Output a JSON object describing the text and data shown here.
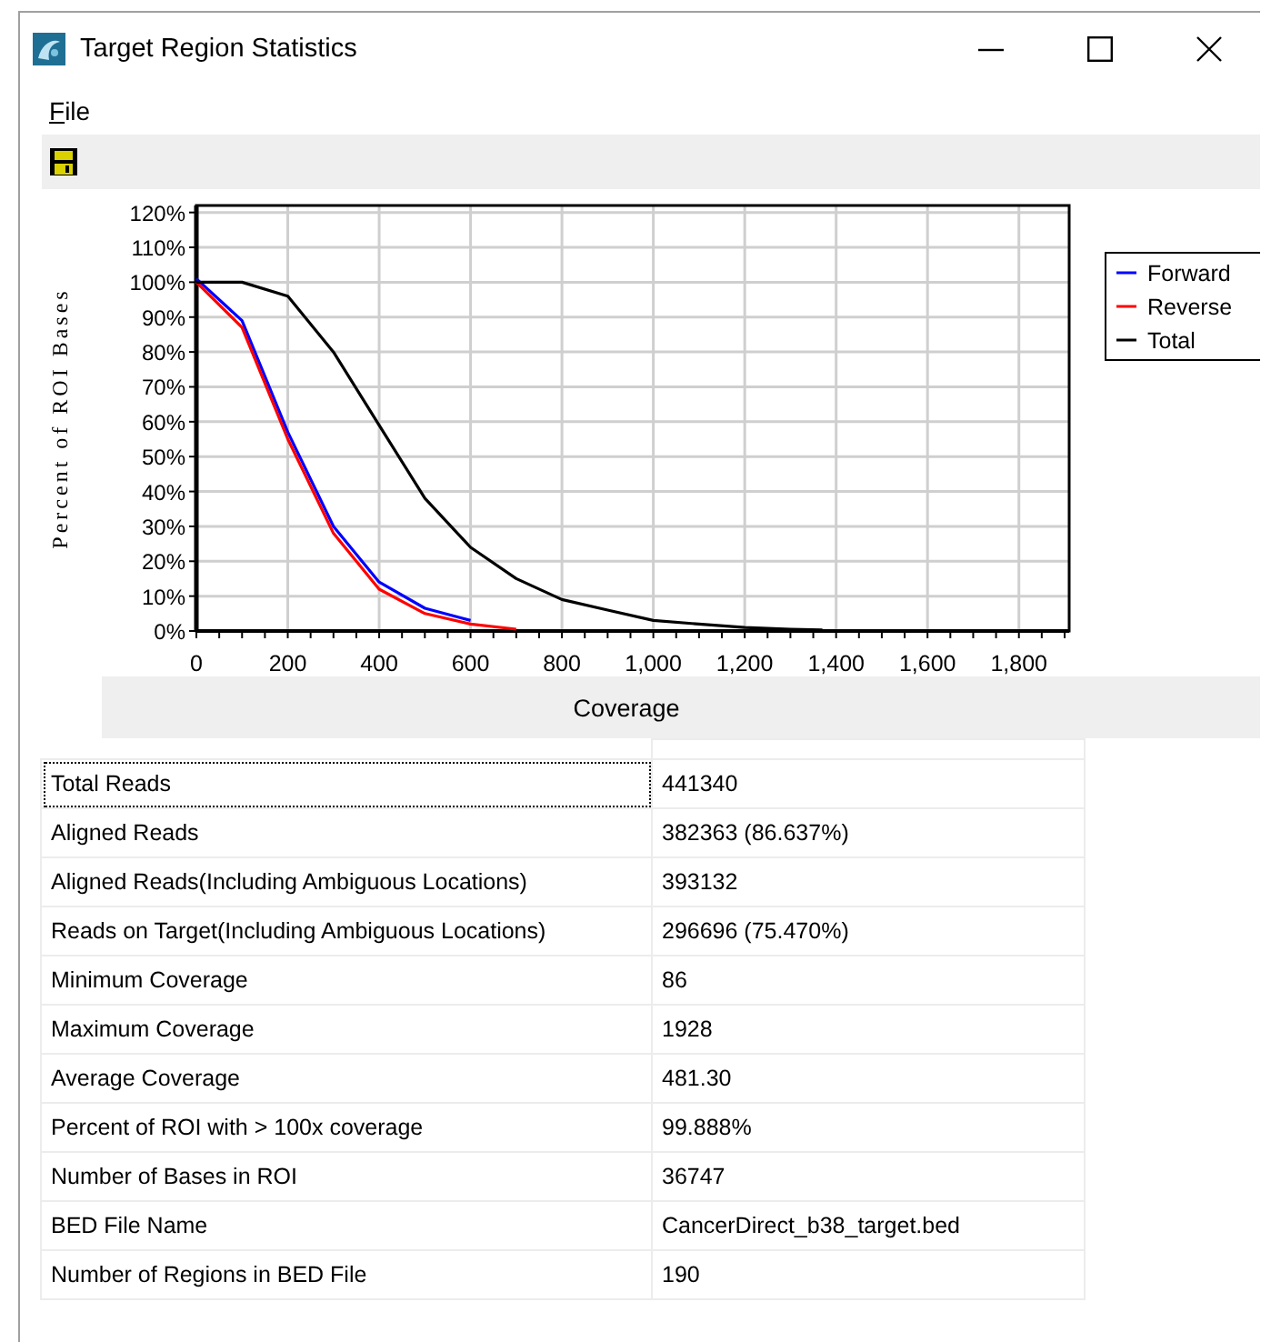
{
  "window": {
    "title": "Target Region Statistics"
  },
  "menu": [
    {
      "label": "File"
    }
  ],
  "toolbar": [
    {
      "kind": "save"
    }
  ],
  "chart": {
    "chart_data": {
      "type": "line",
      "xlabel": "Coverage",
      "ylabel": "Percent of ROI Bases",
      "x": [
        0,
        100,
        200,
        300,
        400,
        500,
        600,
        700,
        800,
        900,
        1000,
        1100,
        1200,
        1300,
        1370
      ],
      "series": [
        {
          "name": "Forward",
          "color": "#0000ff",
          "values": [
            101,
            89,
            57,
            30,
            14,
            6.5,
            3,
            null,
            null,
            null,
            null,
            null,
            null,
            null,
            null
          ]
        },
        {
          "name": "Reverse",
          "color": "#ff0000",
          "values": [
            100,
            87,
            55,
            28,
            12,
            5,
            2,
            0.5,
            null,
            null,
            null,
            null,
            null,
            null,
            null
          ]
        },
        {
          "name": "Total",
          "color": "#000000",
          "values": [
            100,
            100,
            96,
            80,
            59,
            38,
            24,
            15,
            9,
            6,
            3,
            2,
            1,
            0.5,
            0.3
          ]
        }
      ],
      "xlim": [
        0,
        1910
      ],
      "ylim": [
        0,
        122
      ],
      "grid": true,
      "legend": true,
      "xticks": [
        {
          "value": 0,
          "label": "0"
        },
        {
          "value": 200,
          "label": "200"
        },
        {
          "value": 400,
          "label": "400"
        },
        {
          "value": 600,
          "label": "600"
        },
        {
          "value": 800,
          "label": "800"
        },
        {
          "value": 1000,
          "label": "1,000"
        },
        {
          "value": 1200,
          "label": "1,200"
        },
        {
          "value": 1400,
          "label": "1,400"
        },
        {
          "value": 1600,
          "label": "1,600"
        },
        {
          "value": 1800,
          "label": "1,800"
        }
      ],
      "yticks": [
        {
          "value": 0,
          "label": "0%"
        },
        {
          "value": 10,
          "label": "10%"
        },
        {
          "value": 20,
          "label": "20%"
        },
        {
          "value": 30,
          "label": "30%"
        },
        {
          "value": 40,
          "label": "40%"
        },
        {
          "value": 50,
          "label": "50%"
        },
        {
          "value": 60,
          "label": "60%"
        },
        {
          "value": 70,
          "label": "70%"
        },
        {
          "value": 80,
          "label": "80%"
        },
        {
          "value": 90,
          "label": "90%"
        },
        {
          "value": 100,
          "label": "100%"
        },
        {
          "value": 110,
          "label": "110%"
        },
        {
          "value": 120,
          "label": "120%"
        }
      ]
    }
  },
  "table": {
    "rows": [
      {
        "label": "Total Reads",
        "value": "441340",
        "selected": true
      },
      {
        "label": "Aligned Reads",
        "value": "382363 (86.637%)",
        "selected": false
      },
      {
        "label": "Aligned Reads(Including Ambiguous Locations)",
        "value": "393132",
        "selected": false
      },
      {
        "label": "Reads on Target(Including Ambiguous Locations)",
        "value": "296696 (75.470%)",
        "selected": false
      },
      {
        "label": "Minimum Coverage",
        "value": "86",
        "selected": false
      },
      {
        "label": "Maximum Coverage",
        "value": "1928",
        "selected": false
      },
      {
        "label": "Average Coverage",
        "value": "481.30",
        "selected": false
      },
      {
        "label": "Percent of ROI with > 100x coverage",
        "value": "99.888%",
        "selected": false
      },
      {
        "label": "Number of Bases in ROI",
        "value": "36747",
        "selected": false
      },
      {
        "label": "BED File Name",
        "value": "CancerDirect_b38_target.bed",
        "selected": false
      },
      {
        "label": "Number of Regions in BED File",
        "value": "190",
        "selected": false
      }
    ]
  }
}
